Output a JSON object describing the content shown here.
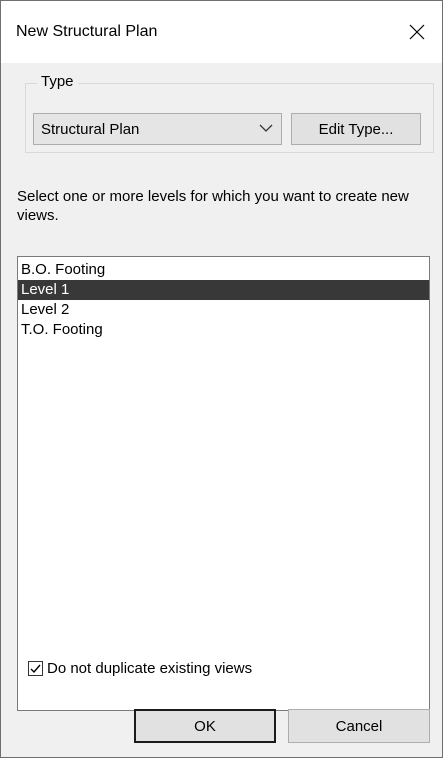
{
  "window": {
    "title": "New Structural Plan"
  },
  "type_group": {
    "label": "Type",
    "selected_type": "Structural Plan",
    "edit_type_label": "Edit Type..."
  },
  "instruction": "Select one or more levels for which you want to create new views.",
  "levels": {
    "items": [
      {
        "label": "B.O. Footing",
        "selected": false
      },
      {
        "label": "Level 1",
        "selected": true
      },
      {
        "label": "Level 2",
        "selected": false
      },
      {
        "label": "T.O. Footing",
        "selected": false
      }
    ]
  },
  "options": {
    "no_duplicate_label": "Do not duplicate existing views",
    "no_duplicate_checked": true
  },
  "buttons": {
    "ok_label": "OK",
    "cancel_label": "Cancel"
  },
  "colors": {
    "selection_bg": "#383838",
    "dialog_bg": "#f0f0f0"
  }
}
